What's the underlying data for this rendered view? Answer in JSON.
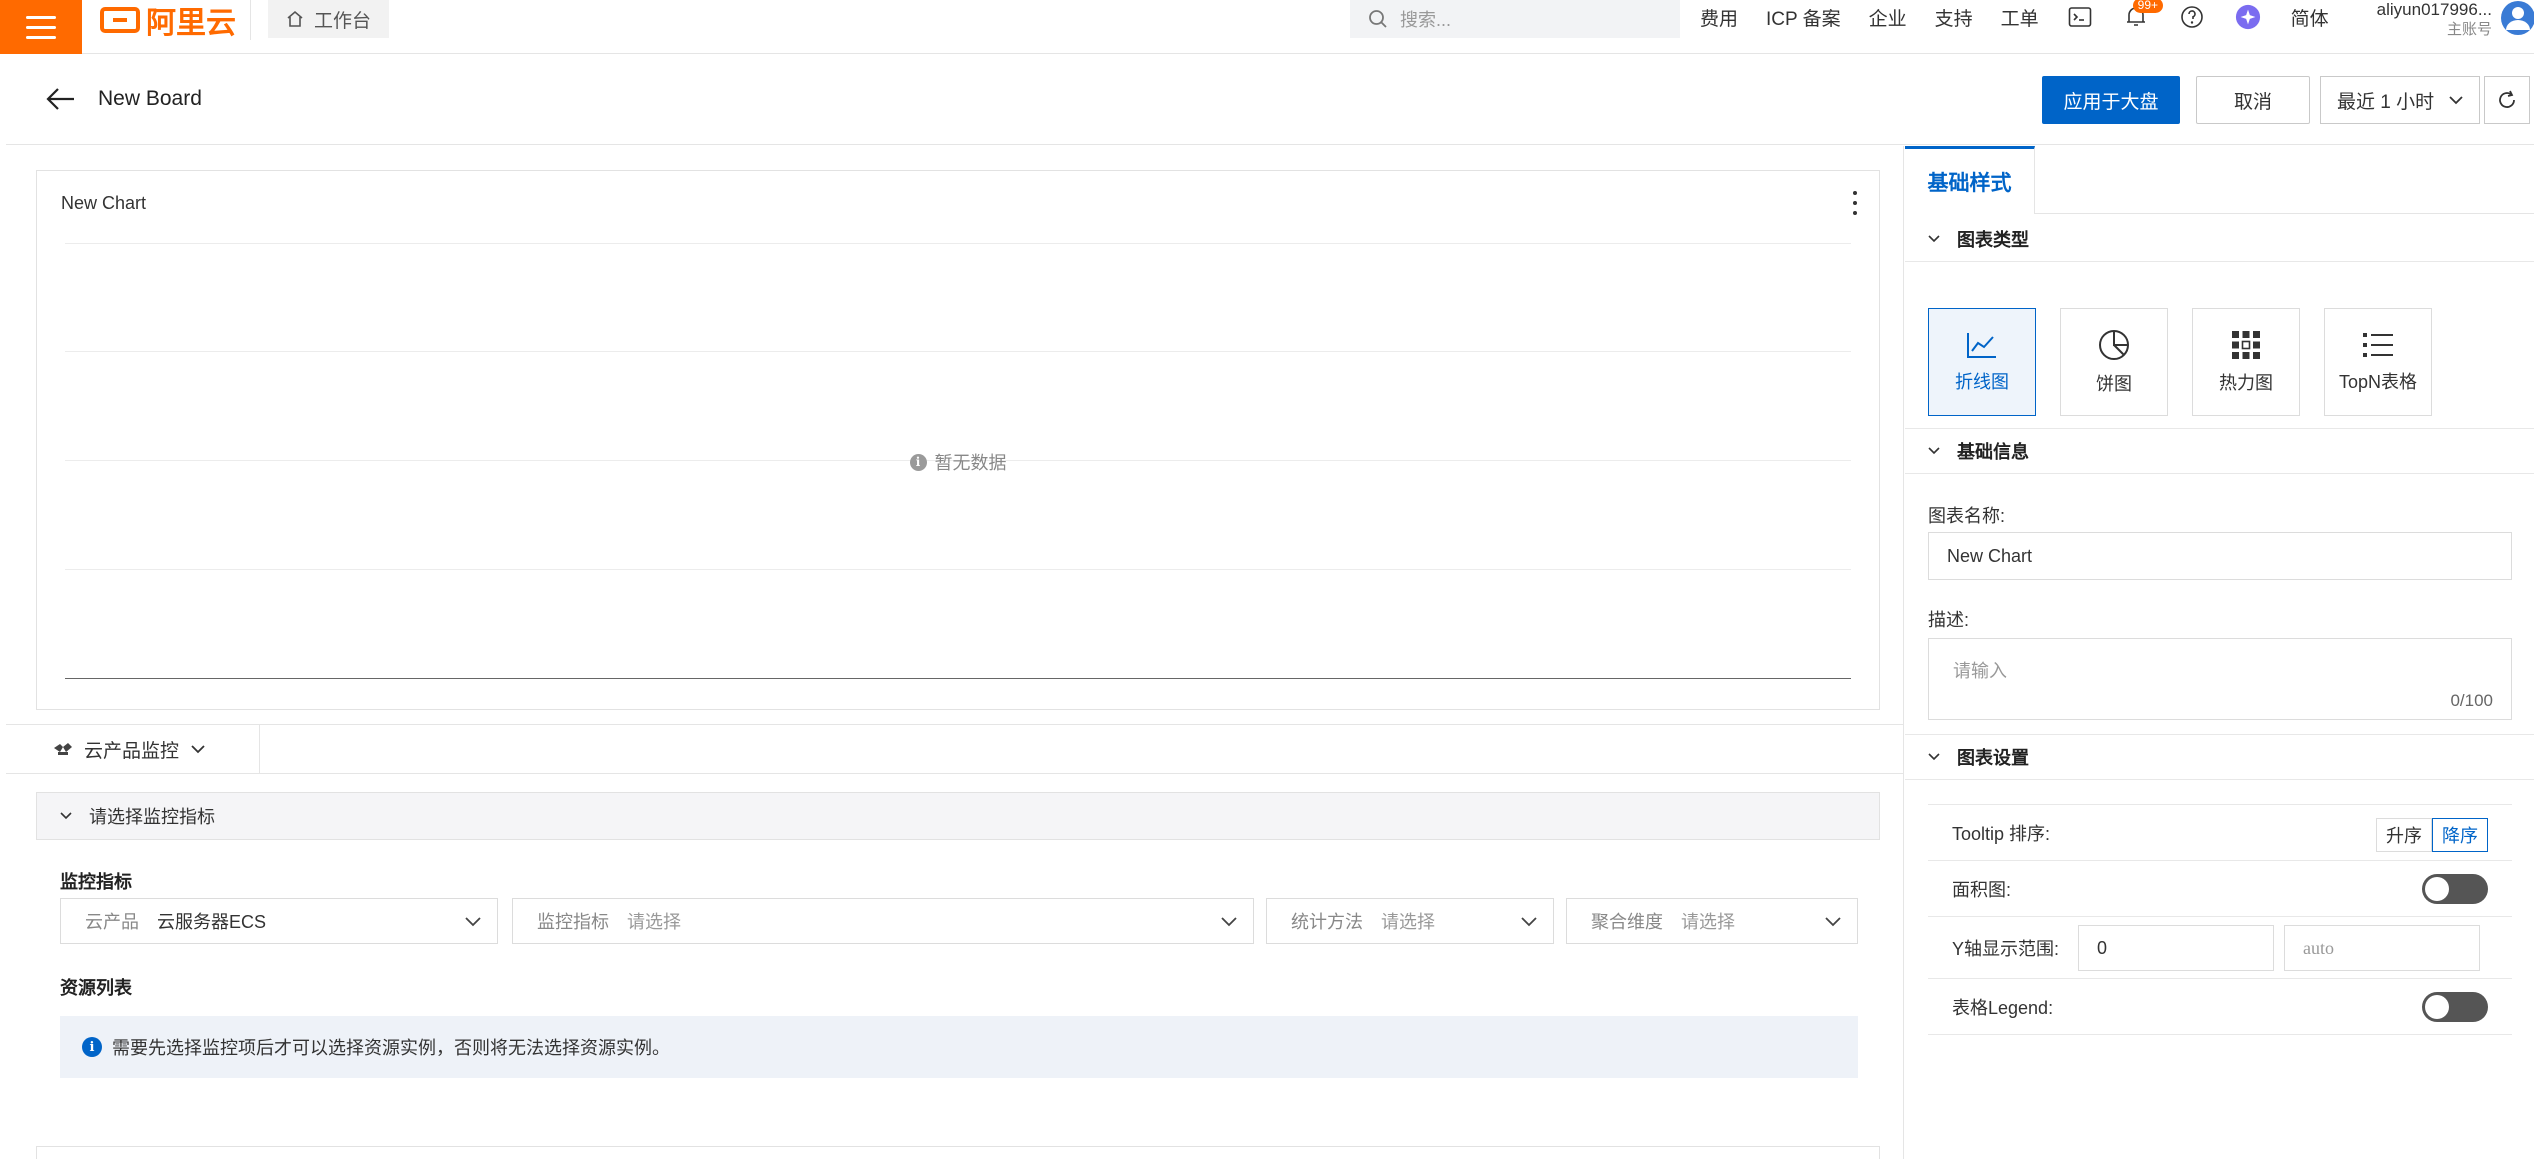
{
  "topbar": {
    "logo_text": "阿里云",
    "workbench_label": "工作台",
    "search_placeholder": "搜索...",
    "nav_items": [
      "费用",
      "ICP 备案",
      "企业",
      "支持",
      "工单"
    ],
    "notification_count": "99+",
    "language": "简体",
    "account_name": "aliyun017996...",
    "account_type": "主账号",
    "brand_color": "#ff6a00"
  },
  "header": {
    "title": "New Board",
    "apply_button": "应用于大盘",
    "cancel_button": "取消",
    "time_range": "最近 1 小时",
    "accent_color": "#0064c8"
  },
  "chart_card": {
    "title": "New Chart",
    "empty_text": "暂无数据"
  },
  "chart_data": {
    "type": "line",
    "title": "New Chart",
    "series": [],
    "grid": true
  },
  "source": {
    "tab_label": "云产品监控"
  },
  "metric": {
    "section_title": "请选择监控指标",
    "metric_label": "监控指标",
    "resource_label": "资源列表",
    "product_label": "云产品",
    "product_value": "云服务器ECS",
    "metric_field_label": "监控指标",
    "method_label": "统计方法",
    "dimension_label": "聚合维度",
    "select_placeholder": "请选择",
    "notice": "需要先选择监控项后才可以选择资源实例，否则将无法选择资源实例。"
  },
  "panel": {
    "tab": "基础样式",
    "chart_type_section": "图表类型",
    "chart_types": [
      "折线图",
      "饼图",
      "热力图",
      "TopN表格"
    ],
    "selected_chart_type": "折线图",
    "basic_info_section": "基础信息",
    "name_label": "图表名称:",
    "name_value": "New Chart",
    "desc_label": "描述:",
    "desc_placeholder": "请输入",
    "desc_count": "0/100",
    "settings_section": "图表设置",
    "tooltip_sort_label": "Tooltip 排序:",
    "sort_asc": "升序",
    "sort_desc": "降序",
    "area_label": "面积图:",
    "area_enabled": false,
    "y_range_label": "Y轴显示范围:",
    "y_min": "0",
    "y_max_placeholder": "auto",
    "legend_label": "表格Legend:",
    "legend_enabled": false
  }
}
